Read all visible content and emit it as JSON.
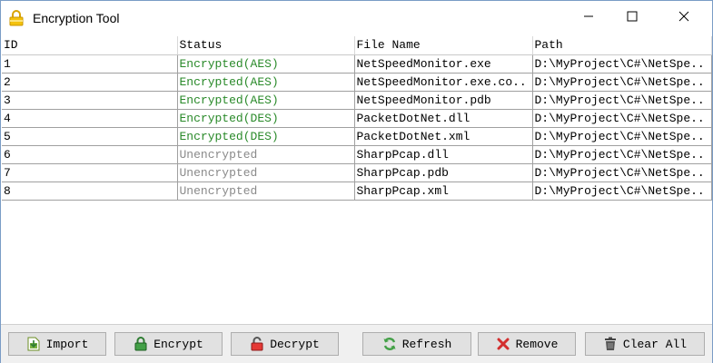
{
  "window": {
    "title": "Encryption Tool",
    "icon": "lock-icon",
    "controls": [
      "minimize-icon",
      "maximize-icon",
      "close-icon"
    ]
  },
  "table": {
    "columns": [
      "ID",
      "Status",
      "File Name",
      "Path"
    ],
    "rows": [
      {
        "id": "1",
        "status": "Encrypted(AES)",
        "status_kind": "encrypted",
        "file": "NetSpeedMonitor.exe",
        "path": "D:\\MyProject\\C#\\NetSpe.."
      },
      {
        "id": "2",
        "status": "Encrypted(AES)",
        "status_kind": "encrypted",
        "file": "NetSpeedMonitor.exe.co..",
        "path": "D:\\MyProject\\C#\\NetSpe.."
      },
      {
        "id": "3",
        "status": "Encrypted(AES)",
        "status_kind": "encrypted",
        "file": "NetSpeedMonitor.pdb",
        "path": "D:\\MyProject\\C#\\NetSpe.."
      },
      {
        "id": "4",
        "status": "Encrypted(DES)",
        "status_kind": "encrypted",
        "file": "PacketDotNet.dll",
        "path": "D:\\MyProject\\C#\\NetSpe.."
      },
      {
        "id": "5",
        "status": "Encrypted(DES)",
        "status_kind": "encrypted",
        "file": "PacketDotNet.xml",
        "path": "D:\\MyProject\\C#\\NetSpe.."
      },
      {
        "id": "6",
        "status": "Unencrypted",
        "status_kind": "unencrypted",
        "file": "SharpPcap.dll",
        "path": "D:\\MyProject\\C#\\NetSpe.."
      },
      {
        "id": "7",
        "status": "Unencrypted",
        "status_kind": "unencrypted",
        "file": "SharpPcap.pdb",
        "path": "D:\\MyProject\\C#\\NetSpe.."
      },
      {
        "id": "8",
        "status": "Unencrypted",
        "status_kind": "unencrypted",
        "file": "SharpPcap.xml",
        "path": "D:\\MyProject\\C#\\NetSpe.."
      }
    ]
  },
  "toolbar": {
    "import": {
      "label": "Import",
      "icon": "import-icon"
    },
    "encrypt": {
      "label": "Encrypt",
      "icon": "locked-padlock-icon"
    },
    "decrypt": {
      "label": "Decrypt",
      "icon": "unlocked-padlock-icon"
    },
    "refresh": {
      "label": "Refresh",
      "icon": "refresh-icon"
    },
    "remove": {
      "label": "Remove",
      "icon": "remove-icon"
    },
    "clear_all": {
      "label": "Clear All",
      "icon": "trash-icon"
    }
  },
  "colors": {
    "encrypted_text": "#2a8a2a",
    "unencrypted_text": "#8a8a8a",
    "toolbar_bg": "#f0f0f0",
    "button_bg": "#e1e1e1"
  }
}
